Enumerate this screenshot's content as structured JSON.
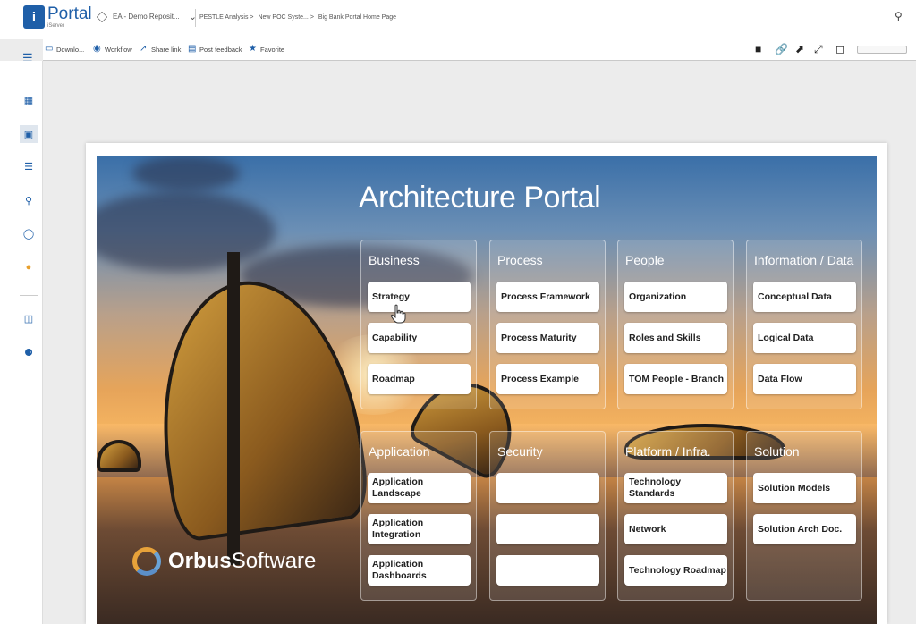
{
  "app": {
    "logo_mark": "i",
    "logo_title": "Portal",
    "logo_sub": "iServer",
    "repository": "EA - Demo Reposit...",
    "breadcrumbs": [
      "PESTLE Analysis >",
      "New POC Syste... >",
      "Big Bank Portal Home Page"
    ]
  },
  "toolbar": {
    "download": "Downlo...",
    "workflow": "Workflow",
    "share": "Share link",
    "feedback": "Post feedback",
    "favorite": "Favorite"
  },
  "portal": {
    "title": "Architecture Portal",
    "brand_first": "Orbus",
    "brand_second": "Software",
    "groups": [
      {
        "title": "Business",
        "tiles": [
          "Strategy",
          "Capability",
          "Roadmap"
        ]
      },
      {
        "title": "Process",
        "tiles": [
          "Process Framework",
          "Process Maturity",
          "Process Example"
        ]
      },
      {
        "title": "People",
        "tiles": [
          "Organization",
          "Roles and Skills",
          "TOM People - Branch"
        ]
      },
      {
        "title": "Information / Data",
        "tiles": [
          "Conceptual Data",
          "Logical Data",
          "Data Flow"
        ]
      },
      {
        "title": "Application",
        "tiles": [
          "Application Landscape",
          "Application Integration",
          "Application Dashboards"
        ]
      },
      {
        "title": "Security",
        "tiles": [
          "",
          "",
          ""
        ]
      },
      {
        "title": "Platform / Infra.",
        "tiles": [
          "Technology Standards",
          "Network",
          "Technology Roadmap"
        ]
      },
      {
        "title": "Solution",
        "tiles": [
          "Solution Models",
          "Solution Arch Doc."
        ]
      }
    ]
  },
  "colors": {
    "brand": "#1f5fa8",
    "tile": "#ffffff",
    "tile_text": "#222222"
  }
}
